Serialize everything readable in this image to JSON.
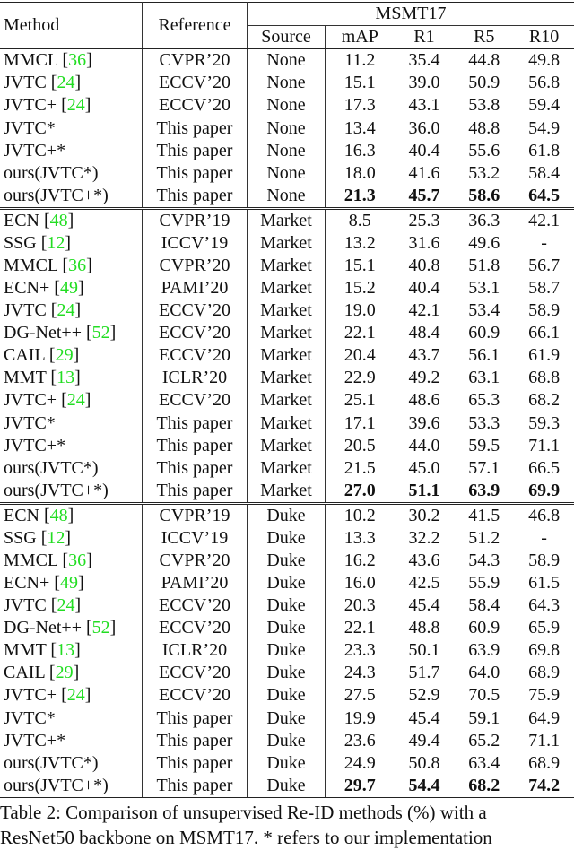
{
  "table": {
    "headers": {
      "method": "Method",
      "reference": "Reference",
      "dataset": "MSMT17",
      "source": "Source",
      "metrics": [
        "mAP",
        "R1",
        "R5",
        "R10"
      ]
    },
    "sections": [
      {
        "groups": [
          [
            {
              "method": "MMCL",
              "cite": "36",
              "reference": "CVPR’20",
              "source": "None",
              "values": [
                "11.2",
                "35.4",
                "44.8",
                "49.8"
              ],
              "bold": false
            },
            {
              "method": "JVTC",
              "cite": "24",
              "reference": "ECCV’20",
              "source": "None",
              "values": [
                "15.1",
                "39.0",
                "50.9",
                "56.8"
              ],
              "bold": false
            },
            {
              "method": "JVTC+",
              "cite": "24",
              "reference": "ECCV’20",
              "source": "None",
              "values": [
                "17.3",
                "43.1",
                "53.8",
                "59.4"
              ],
              "bold": false
            }
          ],
          [
            {
              "method": "JVTC*",
              "cite": "",
              "reference": "This paper",
              "source": "None",
              "values": [
                "13.4",
                "36.0",
                "48.8",
                "54.9"
              ],
              "bold": false
            },
            {
              "method": "JVTC+*",
              "cite": "",
              "reference": "This paper",
              "source": "None",
              "values": [
                "16.3",
                "40.4",
                "55.6",
                "61.8"
              ],
              "bold": false
            },
            {
              "method": "ours(JVTC*)",
              "cite": "",
              "reference": "This paper",
              "source": "None",
              "values": [
                "18.0",
                "41.6",
                "53.2",
                "58.4"
              ],
              "bold": false
            },
            {
              "method": "ours(JVTC+*)",
              "cite": "",
              "reference": "This paper",
              "source": "None",
              "values": [
                "21.3",
                "45.7",
                "58.6",
                "64.5"
              ],
              "bold": true
            }
          ]
        ]
      },
      {
        "groups": [
          [
            {
              "method": "ECN",
              "cite": "48",
              "reference": "CVPR’19",
              "source": "Market",
              "values": [
                "8.5",
                "25.3",
                "36.3",
                "42.1"
              ],
              "bold": false
            },
            {
              "method": "SSG",
              "cite": "12",
              "reference": "ICCV’19",
              "source": "Market",
              "values": [
                "13.2",
                "31.6",
                "49.6",
                "-"
              ],
              "bold": false
            },
            {
              "method": "MMCL",
              "cite": "36",
              "reference": "CVPR’20",
              "source": "Market",
              "values": [
                "15.1",
                "40.8",
                "51.8",
                "56.7"
              ],
              "bold": false
            },
            {
              "method": "ECN+",
              "cite": "49",
              "reference": "PAMI’20",
              "source": "Market",
              "values": [
                "15.2",
                "40.4",
                "53.1",
                "58.7"
              ],
              "bold": false
            },
            {
              "method": "JVTC",
              "cite": "24",
              "reference": "ECCV’20",
              "source": "Market",
              "values": [
                "19.0",
                "42.1",
                "53.4",
                "58.9"
              ],
              "bold": false
            },
            {
              "method": "DG-Net++",
              "cite": "52",
              "reference": "ECCV’20",
              "source": "Market",
              "values": [
                "22.1",
                "48.4",
                "60.9",
                "66.1"
              ],
              "bold": false
            },
            {
              "method": "CAIL",
              "cite": "29",
              "reference": "ECCV’20",
              "source": "Market",
              "values": [
                "20.4",
                "43.7",
                "56.1",
                "61.9"
              ],
              "bold": false
            },
            {
              "method": "MMT",
              "cite": "13",
              "reference": "ICLR’20",
              "source": "Market",
              "values": [
                "22.9",
                "49.2",
                "63.1",
                "68.8"
              ],
              "bold": false
            },
            {
              "method": "JVTC+",
              "cite": "24",
              "reference": "ECCV’20",
              "source": "Market",
              "values": [
                "25.1",
                "48.6",
                "65.3",
                "68.2"
              ],
              "bold": false
            }
          ],
          [
            {
              "method": "JVTC*",
              "cite": "",
              "reference": "This paper",
              "source": "Market",
              "values": [
                "17.1",
                "39.6",
                "53.3",
                "59.3"
              ],
              "bold": false
            },
            {
              "method": "JVTC+*",
              "cite": "",
              "reference": "This paper",
              "source": "Market",
              "values": [
                "20.5",
                "44.0",
                "59.5",
                "71.1"
              ],
              "bold": false
            },
            {
              "method": "ours(JVTC*)",
              "cite": "",
              "reference": "This paper",
              "source": "Market",
              "values": [
                "21.5",
                "45.0",
                "57.1",
                "66.5"
              ],
              "bold": false
            },
            {
              "method": "ours(JVTC+*)",
              "cite": "",
              "reference": "This paper",
              "source": "Market",
              "values": [
                "27.0",
                "51.1",
                "63.9",
                "69.9"
              ],
              "bold": true
            }
          ]
        ]
      },
      {
        "groups": [
          [
            {
              "method": "ECN",
              "cite": "48",
              "reference": "CVPR’19",
              "source": "Duke",
              "values": [
                "10.2",
                "30.2",
                "41.5",
                "46.8"
              ],
              "bold": false
            },
            {
              "method": "SSG",
              "cite": "12",
              "reference": "ICCV’19",
              "source": "Duke",
              "values": [
                "13.3",
                "32.2",
                "51.2",
                "-"
              ],
              "bold": false
            },
            {
              "method": "MMCL",
              "cite": "36",
              "reference": "CVPR’20",
              "source": "Duke",
              "values": [
                "16.2",
                "43.6",
                "54.3",
                "58.9"
              ],
              "bold": false
            },
            {
              "method": "ECN+",
              "cite": "49",
              "reference": "PAMI’20",
              "source": "Duke",
              "values": [
                "16.0",
                "42.5",
                "55.9",
                "61.5"
              ],
              "bold": false
            },
            {
              "method": "JVTC",
              "cite": "24",
              "reference": "ECCV’20",
              "source": "Duke",
              "values": [
                "20.3",
                "45.4",
                "58.4",
                "64.3"
              ],
              "bold": false
            },
            {
              "method": "DG-Net++",
              "cite": "52",
              "reference": "ECCV’20",
              "source": "Duke",
              "values": [
                "22.1",
                "48.8",
                "60.9",
                "65.9"
              ],
              "bold": false
            },
            {
              "method": "MMT",
              "cite": "13",
              "reference": "ICLR’20",
              "source": "Duke",
              "values": [
                "23.3",
                "50.1",
                "63.9",
                "69.8"
              ],
              "bold": false
            },
            {
              "method": "CAIL",
              "cite": "29",
              "reference": "ECCV’20",
              "source": "Duke",
              "values": [
                "24.3",
                "51.7",
                "64.0",
                "68.9"
              ],
              "bold": false
            },
            {
              "method": "JVTC+",
              "cite": "24",
              "reference": "ECCV’20",
              "source": "Duke",
              "values": [
                "27.5",
                "52.9",
                "70.5",
                "75.9"
              ],
              "bold": false
            }
          ],
          [
            {
              "method": "JVTC*",
              "cite": "",
              "reference": "This paper",
              "source": "Duke",
              "values": [
                "19.9",
                "45.4",
                "59.1",
                "64.9"
              ],
              "bold": false
            },
            {
              "method": "JVTC+*",
              "cite": "",
              "reference": "This paper",
              "source": "Duke",
              "values": [
                "23.6",
                "49.4",
                "65.2",
                "71.1"
              ],
              "bold": false
            },
            {
              "method": "ours(JVTC*)",
              "cite": "",
              "reference": "This paper",
              "source": "Duke",
              "values": [
                "24.9",
                "50.8",
                "63.4",
                "68.9"
              ],
              "bold": false
            },
            {
              "method": "ours(JVTC+*)",
              "cite": "",
              "reference": "This paper",
              "source": "Duke",
              "values": [
                "29.7",
                "54.4",
                "68.2",
                "74.2"
              ],
              "bold": true
            }
          ]
        ]
      }
    ]
  },
  "colors": {
    "citation": "#22dd22",
    "text": "#111111"
  },
  "caption": {
    "line1": "Table 2: Comparison of unsupervised Re-ID methods (%) with a",
    "line2": "ResNet50 backbone on MSMT17. * refers to our implementation"
  }
}
